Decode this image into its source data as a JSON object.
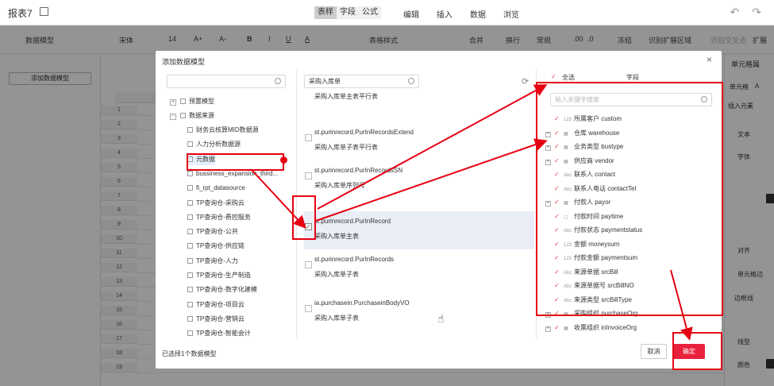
{
  "window": {
    "title": "报表7",
    "mode_tabs": [
      "表样",
      "字段",
      "公式"
    ],
    "menu": [
      "编辑",
      "插入",
      "数据",
      "浏览"
    ]
  },
  "toolbar": {
    "data_model": "数据模型",
    "font": "宋体",
    "font_size": "14",
    "font_grow": "A+",
    "font_shrink": "A-",
    "bold": "B",
    "italic": "I",
    "underline": "U",
    "font_color": "A",
    "table_style": "表格样式",
    "merge": "合并",
    "wrap": "换行",
    "normal": "常规",
    "dec1": ".00",
    "dec2": ".0",
    "freeze": "冻结",
    "identify_area": "识别扩展区域",
    "identify_cross": "识别交叉点",
    "expand": "扩展"
  },
  "leftpanel": {
    "add_model_button": "添加数据模型"
  },
  "sheet": {
    "rows": [
      "1",
      "2",
      "3",
      "4",
      "5",
      "6",
      "7",
      "8",
      "9",
      "10",
      "11",
      "12",
      "13",
      "14",
      "15",
      "16",
      "17",
      "18",
      "19"
    ]
  },
  "rightpanel": {
    "header": "单元格属",
    "cell": "单元格",
    "cell_a": "A",
    "insert_element": "插入元素",
    "text_section": "文本",
    "font": "字体",
    "align": "对齐",
    "cell_border": "单元格边",
    "border_line": "边框线",
    "line_type": "线型",
    "color": "颜色"
  },
  "dialog": {
    "title": "添加数据模型",
    "close": "×",
    "left_search_value": "",
    "tree": {
      "preset": "预置模型",
      "data_source": "数据来源",
      "items": [
        "财务云核算MID数据源",
        "人力分析数据源",
        "元数据",
        "bussiness_expansion_third...",
        "fi_rpt_datasource",
        "TP查询仓-采购云",
        "TP查询仓-费控服务",
        "TP查询仓-公共",
        "TP查询仓-供应链",
        "TP查询仓-人力",
        "TP查询仓-生产制造",
        "TP查询仓-数字化建模",
        "TP查询仓-项目云",
        "TP查询仓-营销云",
        "TP查询仓-智能会计"
      ]
    },
    "middle_search_value": "采购入库单",
    "tables": [
      {
        "code": "",
        "name": "采购入库单主表平行表"
      },
      {
        "code": "st.purinrecord.PurInRecordsExtend",
        "name": "采购入库单子表平行表"
      },
      {
        "code": "st.purinrecord.PurInRecordsSN",
        "name": "采购入库单序列号"
      },
      {
        "code": "st.purinrecord.PurInRecord",
        "name": "采购入库单主表"
      },
      {
        "code": "st.purinrecord.PurInRecords",
        "name": "采购入库单子表"
      },
      {
        "code": "ia.purchasein.PurchaseinBodyVO",
        "name": "采购入库单子表"
      }
    ],
    "fields_header": {
      "select_all": "全选",
      "field": "字段"
    },
    "field_search_placeholder": "输入关键字搜索",
    "fields": [
      {
        "type": "123",
        "label": "所属客户 custom",
        "exp": false
      },
      {
        "type": "▦",
        "label": "仓库 warehouse",
        "exp": true
      },
      {
        "type": "▦",
        "label": "业务类型 bustype",
        "exp": true
      },
      {
        "type": "▦",
        "label": "供应商 vendor",
        "exp": true
      },
      {
        "type": "Abc",
        "label": "联系人 contact",
        "exp": false
      },
      {
        "type": "Abc",
        "label": "联系人电话 contactTel",
        "exp": false
      },
      {
        "type": "▦",
        "label": "付款人 payor",
        "exp": true
      },
      {
        "type": "▢",
        "label": "付款时间 paytime",
        "exp": false
      },
      {
        "type": "Abc",
        "label": "付款状态 paymentstatus",
        "exp": false
      },
      {
        "type": "123",
        "label": "金额 moneysum",
        "exp": false
      },
      {
        "type": "123",
        "label": "付款金额 paymentsum",
        "exp": false
      },
      {
        "type": "Abc",
        "label": "来源单据 srcBill",
        "exp": false
      },
      {
        "type": "Abc",
        "label": "来源单据号 srcBillNO",
        "exp": false
      },
      {
        "type": "Abc",
        "label": "来源类型 srcBillType",
        "exp": false
      },
      {
        "type": "▦",
        "label": "采购组织 purchaseOrg",
        "exp": true
      },
      {
        "type": "▦",
        "label": "收票组织 inInvoiceOrg",
        "exp": true
      }
    ],
    "footer": {
      "selected_count": "已选择1个数据模型",
      "cancel": "取消",
      "ok": "确定"
    }
  }
}
